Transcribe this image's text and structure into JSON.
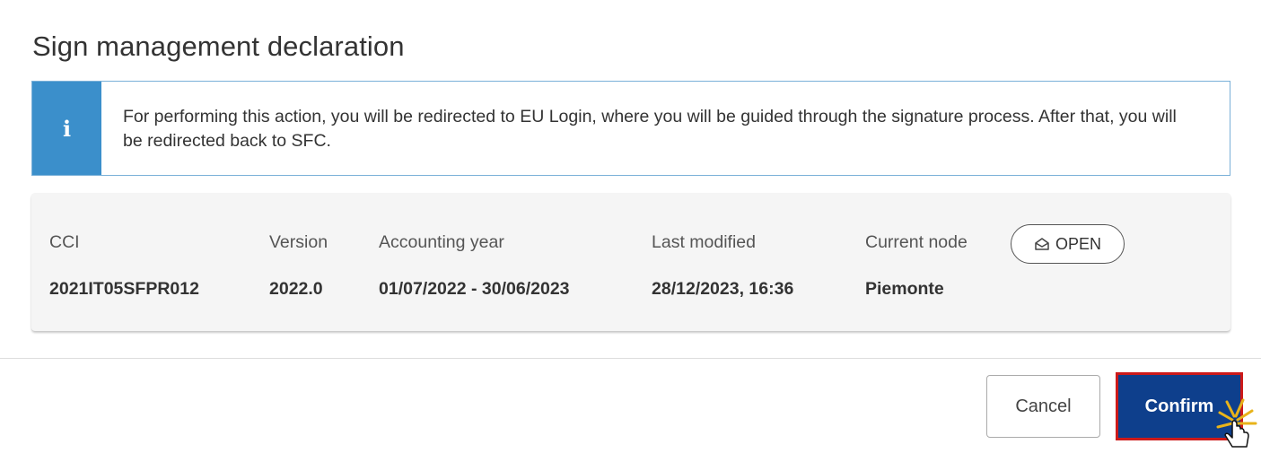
{
  "dialog": {
    "title": "Sign management declaration"
  },
  "info": {
    "icon": "info-icon",
    "icon_glyph": "i",
    "text": "For performing this action, you will be redirected to EU Login, where you will be guided through the signature process. After that, you will be redirected back to SFC."
  },
  "details": {
    "cci": {
      "label": "CCI",
      "value": "2021IT05SFPR012"
    },
    "version": {
      "label": "Version",
      "value": "2022.0"
    },
    "accounting_year": {
      "label": "Accounting year",
      "value": "01/07/2022 - 30/06/2023"
    },
    "last_modified": {
      "label": "Last modified",
      "value": "28/12/2023, 16:36"
    },
    "current_node": {
      "label": "Current node",
      "value": "Piemonte"
    },
    "status_badge": {
      "label": "OPEN",
      "icon": "open-envelope-icon"
    }
  },
  "footer": {
    "cancel_label": "Cancel",
    "confirm_label": "Confirm"
  },
  "colors": {
    "info_accent": "#3b8fcb",
    "confirm_bg": "#0e3f8c",
    "confirm_highlight_border": "#cc1a1a"
  }
}
